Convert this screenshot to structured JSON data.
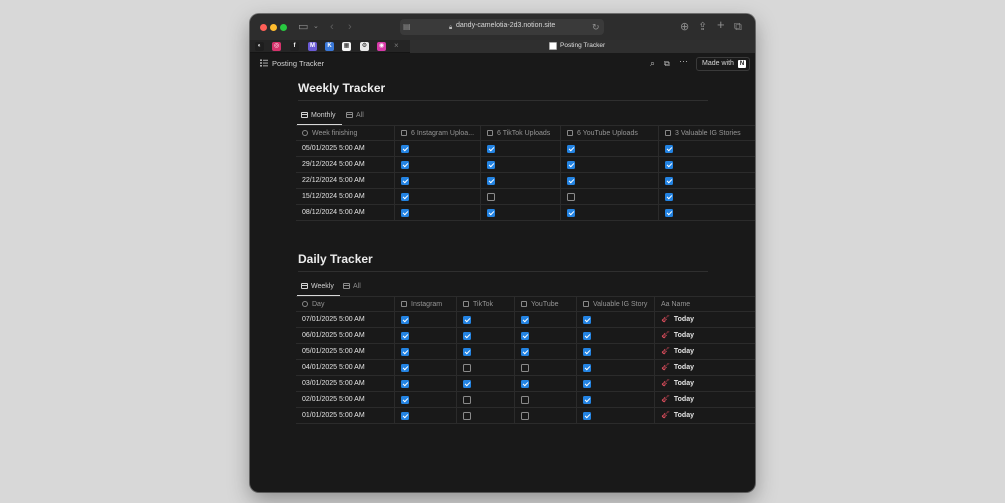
{
  "browser": {
    "url": "dandy-camelotia-2d3.notion.site",
    "active_tab_title": "Posting Tracker",
    "pinned_tabs": [
      {
        "icon": "app-dark-icon",
        "color": "#1e1e1e",
        "glyph": "◐"
      },
      {
        "icon": "instagram-icon",
        "color": "#d6336c",
        "glyph": "◎"
      },
      {
        "icon": "f-app-icon",
        "color": "#202020",
        "glyph": "f"
      },
      {
        "icon": "m-logo-icon",
        "color": "#6b5bd6",
        "glyph": "M"
      },
      {
        "icon": "k-app-icon",
        "color": "#3a78d8",
        "glyph": "K"
      },
      {
        "icon": "grid-app-icon",
        "color": "#f5f5f5",
        "glyph": "▦"
      },
      {
        "icon": "chatgpt-icon",
        "color": "#e8e8e8",
        "glyph": "⚙"
      },
      {
        "icon": "pink-circle-icon",
        "color": "#d63aa8",
        "glyph": "◉"
      }
    ]
  },
  "topbar": {
    "breadcrumb": "Posting Tracker",
    "made_with_label": "Made with"
  },
  "weekly": {
    "title": "Weekly Tracker",
    "views": [
      "Monthly",
      "All"
    ],
    "columns": [
      "Week finishing",
      "6 Instagram Uploa...",
      "6 TikTok Uploads",
      "6 YouTube Uploads",
      "3 Valuable IG Stories"
    ],
    "rows": [
      {
        "date": "05/01/2025 5:00 AM",
        "checks": [
          true,
          true,
          true,
          true
        ]
      },
      {
        "date": "29/12/2024 5:00 AM",
        "checks": [
          true,
          true,
          true,
          true
        ]
      },
      {
        "date": "22/12/2024 5:00 AM",
        "checks": [
          true,
          true,
          true,
          true
        ]
      },
      {
        "date": "15/12/2024 5:00 AM",
        "checks": [
          true,
          false,
          false,
          true
        ]
      },
      {
        "date": "08/12/2024 5:00 AM",
        "checks": [
          true,
          true,
          true,
          true
        ]
      }
    ]
  },
  "daily": {
    "title": "Daily Tracker",
    "views": [
      "Weekly",
      "All"
    ],
    "columns": [
      "Day",
      "Instagram",
      "TikTok",
      "YouTube",
      "Valuable IG Story",
      "Aa Name"
    ],
    "rows": [
      {
        "date": "07/01/2025 5:00 AM",
        "checks": [
          true,
          true,
          true,
          true
        ],
        "name": "Today"
      },
      {
        "date": "06/01/2025 5:00 AM",
        "checks": [
          true,
          true,
          true,
          true
        ],
        "name": "Today"
      },
      {
        "date": "05/01/2025 5:00 AM",
        "checks": [
          true,
          true,
          true,
          true
        ],
        "name": "Today"
      },
      {
        "date": "04/01/2025 5:00 AM",
        "checks": [
          true,
          false,
          false,
          true
        ],
        "name": "Today"
      },
      {
        "date": "03/01/2025 5:00 AM",
        "checks": [
          true,
          true,
          true,
          true
        ],
        "name": "Today"
      },
      {
        "date": "02/01/2025 5:00 AM",
        "checks": [
          true,
          false,
          false,
          true
        ],
        "name": "Today"
      },
      {
        "date": "01/01/2025 5:00 AM",
        "checks": [
          true,
          false,
          false,
          true
        ],
        "name": "Today"
      }
    ]
  },
  "colors": {
    "accent_checkbox": "#2383e2",
    "name_icon": "#e04e5e"
  }
}
